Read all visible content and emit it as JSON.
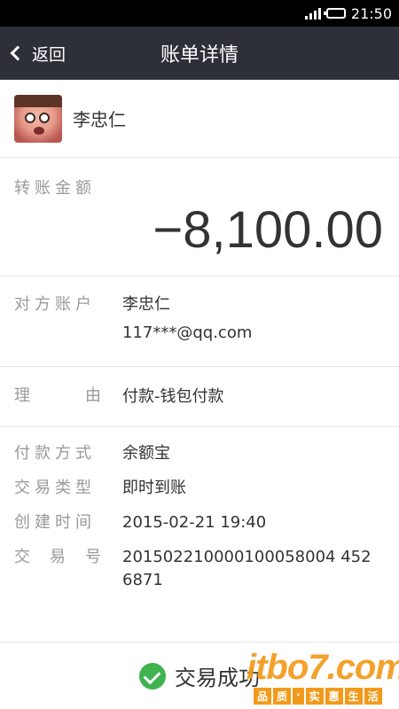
{
  "status_bar": {
    "time": "21:50"
  },
  "nav": {
    "back_label": "返回",
    "title": "账单详情"
  },
  "user": {
    "name": "李忠仁"
  },
  "amount": {
    "label": "转账金额",
    "value": "−8,100.00"
  },
  "account": {
    "label": "对方账户",
    "name": "李忠仁",
    "email": "117***@qq.com"
  },
  "reason": {
    "label_chars": [
      "理",
      "由"
    ],
    "value": "付款-钱包付款"
  },
  "details": [
    {
      "label": "付款方式",
      "value": "余额宝"
    },
    {
      "label": "交易类型",
      "value": "即时到账"
    },
    {
      "label": "创建时间",
      "value": "2015-02-21 19:40"
    }
  ],
  "trade_no": {
    "label_chars": [
      "交",
      "易",
      "号"
    ],
    "value": "201502210000100058004 4526871"
  },
  "footer": {
    "status": "交易成功"
  },
  "watermark": {
    "main": "itbo7.com",
    "tags": [
      "品",
      "质",
      "·",
      "实",
      "惠",
      "生",
      "活"
    ]
  },
  "colors": {
    "nav_bg": "#2e3039",
    "success": "#3fb34f",
    "label": "#9a9a9a",
    "watermark": "#f39a1b"
  }
}
